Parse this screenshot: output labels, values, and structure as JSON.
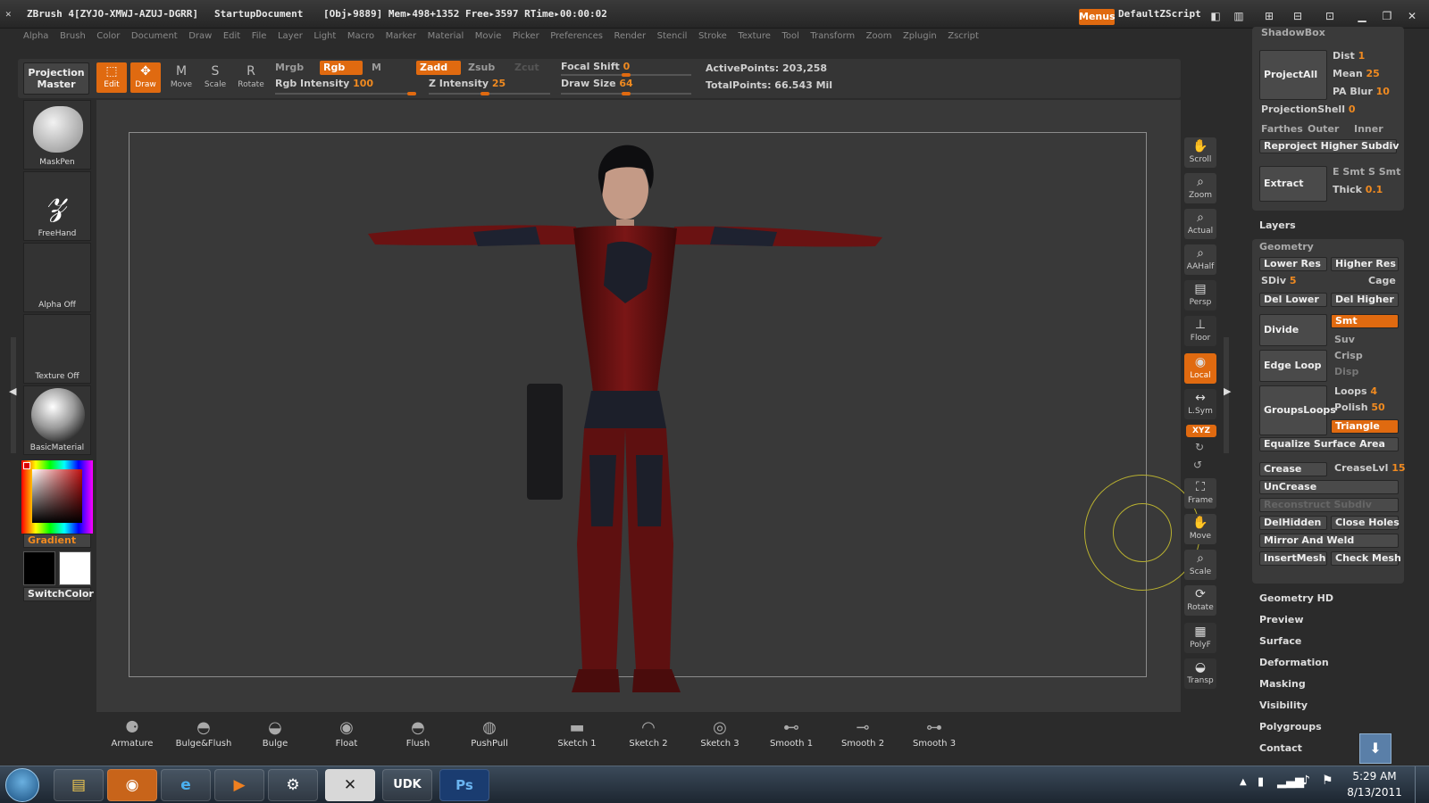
{
  "window": {
    "title_app": "ZBrush 4[ZYJO-XMWJ-AZUJ-DGRR]",
    "document": "StartupDocument",
    "stats": "[Obj▸9889] Mem▸498+1352  Free▸3597  RTime▸00:00:02",
    "menus_label": "Menus",
    "script_label": "DefaultZScript"
  },
  "menubar": [
    "Alpha",
    "Brush",
    "Color",
    "Document",
    "Draw",
    "Edit",
    "File",
    "Layer",
    "Light",
    "Macro",
    "Marker",
    "Material",
    "Movie",
    "Picker",
    "Preferences",
    "Render",
    "Stencil",
    "Stroke",
    "Texture",
    "Tool",
    "Transform",
    "Zoom",
    "Zplugin",
    "Zscript"
  ],
  "shelf": {
    "projection_master": "Projection Master",
    "edit": "Edit",
    "draw": "Draw",
    "move": "Move",
    "scale": "Scale",
    "rotate": "Rotate",
    "mrgb": "Mrgb",
    "rgb": "Rgb",
    "m": "M",
    "zadd": "Zadd",
    "zsub": "Zsub",
    "zcut": "Zcut",
    "rgb_intensity_label": "Rgb  Intensity",
    "rgb_intensity": "100",
    "z_intensity_label": "Z Intensity",
    "z_intensity": "25",
    "focal_shift_label": "Focal Shift",
    "focal_shift": "0",
    "draw_size_label": "Draw Size",
    "draw_size": "64",
    "active_points": "ActivePoints: 203,258",
    "total_points": "TotalPoints: 66.543 Mil"
  },
  "left": {
    "maskpen": "MaskPen",
    "freehand": "FreeHand",
    "alpha": "Alpha  Off",
    "texture": "Texture  Off",
    "material": "BasicMaterial",
    "gradient": "Gradient",
    "switchcolor": "SwitchColor"
  },
  "rightstrip": [
    "Scroll",
    "Zoom",
    "Actual",
    "AAHalf",
    "Persp",
    "Floor",
    "Local",
    "L.Sym",
    "Frame",
    "Move",
    "Scale",
    "Rotate",
    "PolyF",
    "Transp"
  ],
  "rpanel": {
    "shadowbox": "ShadowBox",
    "project_all": "ProjectAll",
    "dist_label": "Dist",
    "dist": "1",
    "mean_label": "Mean",
    "mean": "25",
    "pablur_label": "PA Blur",
    "pablur": "10",
    "projshell_label": "ProjectionShell",
    "projshell": "0",
    "farthest": "Farthes",
    "outer": "Outer",
    "inner": "Inner",
    "reproject": "Reproject Higher Subdiv",
    "extract": "Extract",
    "esmt": "E Smt",
    "ssmt": "S Smt",
    "thick_label": "Thick",
    "thick": "0.1"
  },
  "layers": "Layers",
  "geometry": {
    "title": "Geometry",
    "lower_res": "Lower Res",
    "higher_res": "Higher Res",
    "sdiv_label": "SDiv",
    "sdiv": "5",
    "cage": "Cage",
    "del_lower": "Del Lower",
    "del_higher": "Del Higher",
    "divide": "Divide",
    "smt": "Smt",
    "suv": "Suv",
    "edge_loop": "Edge Loop",
    "crisp": "Crisp",
    "disp": "Disp",
    "groups_loops": "GroupsLoops",
    "loops_label": "Loops",
    "loops": "4",
    "polish_label": "Polish",
    "polish": "50",
    "triangle": "Triangle",
    "equalize": "Equalize Surface Area",
    "crease": "Crease",
    "crease_lvl_label": "CreaseLvl",
    "crease_lvl": "15",
    "uncrease": "UnCrease",
    "reconstruct": "Reconstruct Subdiv",
    "delhidden": "DelHidden",
    "close_holes": "Close Holes",
    "mirror_weld": "Mirror And Weld",
    "insertmesh": "InsertMesh",
    "check_mesh": "Check Mesh"
  },
  "subpalettes": [
    "Geometry HD",
    "Preview",
    "Surface",
    "Deformation",
    "Masking",
    "Visibility",
    "Polygroups",
    "Contact"
  ],
  "brushes": [
    "Armature",
    "Bulge&Flush",
    "Bulge",
    "Float",
    "Flush",
    "PushPull",
    "Sketch 1",
    "Sketch 2",
    "Sketch 3",
    "Smooth 1",
    "Smooth 2",
    "Smooth 3"
  ],
  "taskbar": {
    "time": "5:29 AM",
    "date": "8/13/2011",
    "udk": "UDK",
    "ps": "Ps"
  },
  "colors": {
    "accent": "#e06a10",
    "skin": "#c49a86",
    "suit_red": "#6e1212",
    "suit_dark": "#1c1f2a"
  }
}
